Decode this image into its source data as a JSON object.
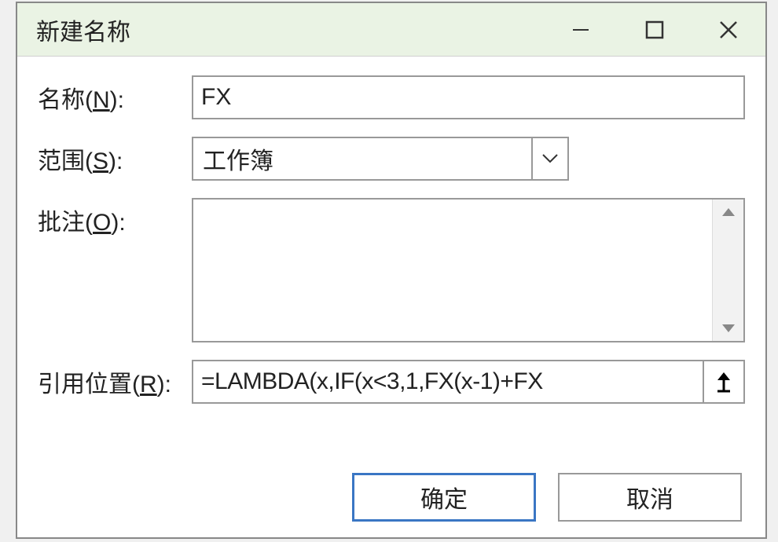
{
  "titlebar": {
    "title": "新建名称"
  },
  "labels": {
    "name": "名称",
    "name_key": "N",
    "scope": "范围",
    "scope_key": "S",
    "comment": "批注",
    "comment_key": "O",
    "reference": "引用位置",
    "reference_key": "R"
  },
  "fields": {
    "name_value": "FX",
    "scope_value": "工作簿",
    "comment_value": "",
    "reference_value": "=LAMBDA(x,IF(x<3,1,FX(x-1)+FX"
  },
  "buttons": {
    "ok": "确定",
    "cancel": "取消"
  }
}
